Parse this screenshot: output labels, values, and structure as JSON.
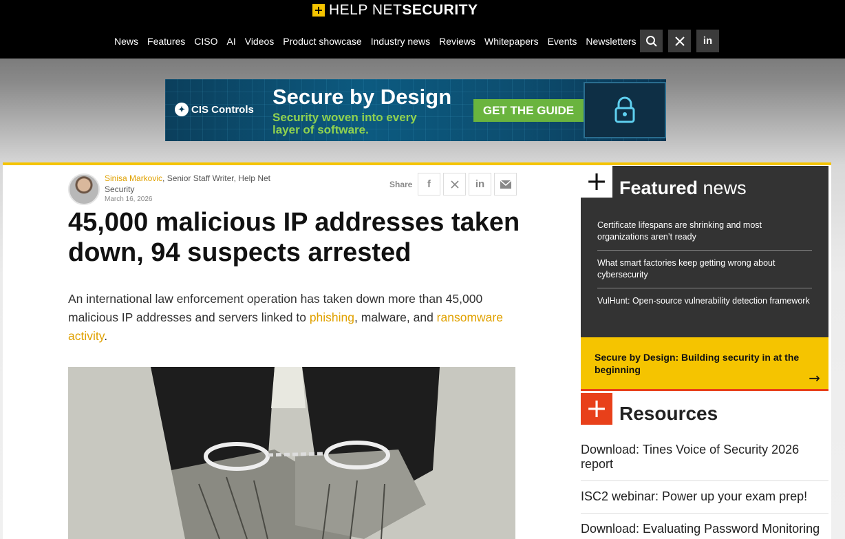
{
  "header": {
    "logo_help": "HELP",
    "logo_net": "NET",
    "logo_security": "SECURITY",
    "nav": [
      "News",
      "Features",
      "CISO",
      "AI",
      "Videos",
      "Product showcase",
      "Industry news",
      "Reviews",
      "Whitepapers",
      "Events",
      "Newsletters"
    ]
  },
  "ad": {
    "brand": "CIS Controls",
    "title": "Secure by Design",
    "subtitle": "Security woven into every layer of software.",
    "cta": "GET THE GUIDE"
  },
  "article": {
    "author_name": "Sinisa Markovic",
    "author_role": ", Senior Staff Writer, Help Net Security",
    "date": "March 16, 2026",
    "share_label": "Share",
    "headline": "45,000 malicious IP addresses taken down, 94 suspects arrested",
    "lede_1": "An international law enforcement operation has taken down more than 45,000 malicious IP addresses and servers linked to ",
    "lede_link_1": "phishing",
    "lede_2": ", malware, and ",
    "lede_link_2": "ransomware activity",
    "lede_3": "."
  },
  "sidebar": {
    "featured_title_bold": "Featured",
    "featured_title_rest": " news",
    "featured_items": [
      "Certificate lifespans are shrinking and most organizations aren’t ready",
      "What smart factories keep getting wrong about cybersecurity",
      "VulHunt: Open-source vulnerability detection framework"
    ],
    "promo": "Secure by Design: Building security in at the beginning",
    "resources_title": "Resources",
    "resources": [
      "Download: Tines Voice of Security 2026 report",
      "ISC2 webinar: Power up your exam prep!",
      "Download: Evaluating Password Monitoring"
    ]
  },
  "colors": {
    "accent": "#f5c400",
    "resources": "#e8401a",
    "featured_bg": "#333333"
  }
}
